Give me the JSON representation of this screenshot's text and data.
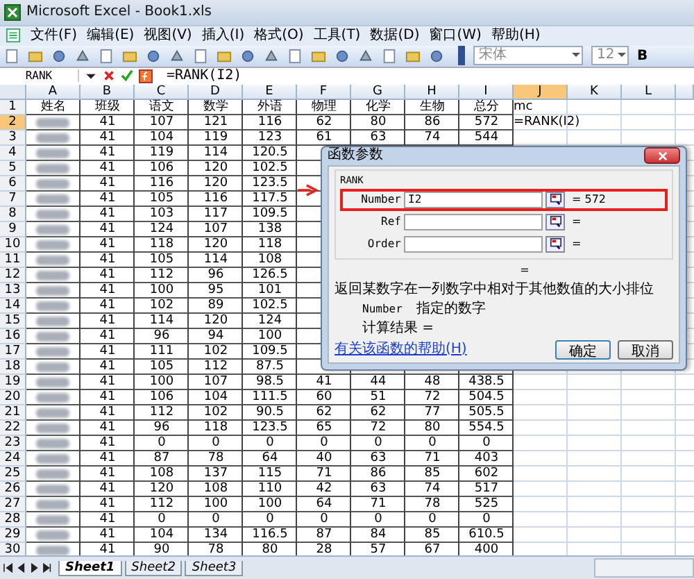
{
  "window": {
    "title": "Microsoft Excel - Book1.xls"
  },
  "menu": [
    "文件(F)",
    "编辑(E)",
    "视图(V)",
    "插入(I)",
    "格式(O)",
    "工具(T)",
    "数据(D)",
    "窗口(W)",
    "帮助(H)"
  ],
  "toolbar": {
    "font": "宋体",
    "size": "12",
    "bold": "B"
  },
  "formula_bar": {
    "name_box": "RANK",
    "formula": "=RANK(I2)"
  },
  "columns": [
    {
      "label": "A",
      "selected": false
    },
    {
      "label": "B",
      "selected": false
    },
    {
      "label": "C",
      "selected": false
    },
    {
      "label": "D",
      "selected": false
    },
    {
      "label": "E",
      "selected": false
    },
    {
      "label": "F",
      "selected": false
    },
    {
      "label": "G",
      "selected": false
    },
    {
      "label": "H",
      "selected": false
    },
    {
      "label": "I",
      "selected": false
    },
    {
      "label": "J",
      "selected": true
    },
    {
      "label": "K",
      "selected": false
    },
    {
      "label": "L",
      "selected": false
    }
  ],
  "rows": [
    {
      "number": "1",
      "selected": false,
      "name_blurred": false,
      "cells": [
        "姓名",
        "班级",
        "语文",
        "数学",
        "外语",
        "物理",
        "化学",
        "生物",
        "总分",
        "mc",
        null,
        null
      ]
    },
    {
      "number": "2",
      "selected": true,
      "name_blurred": true,
      "cells": [
        null,
        "41",
        "107",
        "121",
        "116",
        "62",
        "80",
        "86",
        "572",
        "=RANK(I2)",
        null,
        null
      ]
    },
    {
      "number": "3",
      "selected": false,
      "name_blurred": true,
      "cells": [
        null,
        "41",
        "104",
        "119",
        "123",
        "61",
        "63",
        "74",
        "544",
        null,
        null,
        null
      ]
    },
    {
      "number": "4",
      "selected": false,
      "name_blurred": true,
      "cells": [
        null,
        "41",
        "119",
        "114",
        "120.5",
        null,
        null,
        null,
        null,
        null,
        null,
        null
      ]
    },
    {
      "number": "5",
      "selected": false,
      "name_blurred": true,
      "cells": [
        null,
        "41",
        "106",
        "120",
        "102.5",
        null,
        null,
        null,
        null,
        null,
        null,
        null
      ]
    },
    {
      "number": "6",
      "selected": false,
      "name_blurred": true,
      "cells": [
        null,
        "41",
        "116",
        "120",
        "123.5",
        null,
        null,
        null,
        null,
        null,
        null,
        null
      ]
    },
    {
      "number": "7",
      "selected": false,
      "name_blurred": true,
      "cells": [
        null,
        "41",
        "105",
        "116",
        "117.5",
        null,
        null,
        null,
        null,
        null,
        null,
        null
      ]
    },
    {
      "number": "8",
      "selected": false,
      "name_blurred": true,
      "cells": [
        null,
        "41",
        "103",
        "117",
        "109.5",
        null,
        null,
        null,
        null,
        null,
        null,
        null
      ]
    },
    {
      "number": "9",
      "selected": false,
      "name_blurred": true,
      "cells": [
        null,
        "41",
        "124",
        "107",
        "138",
        null,
        null,
        null,
        null,
        null,
        null,
        null
      ]
    },
    {
      "number": "10",
      "selected": false,
      "name_blurred": true,
      "cells": [
        null,
        "41",
        "118",
        "120",
        "118",
        null,
        null,
        null,
        null,
        null,
        null,
        null
      ]
    },
    {
      "number": "11",
      "selected": false,
      "name_blurred": true,
      "cells": [
        null,
        "41",
        "105",
        "114",
        "108",
        null,
        null,
        null,
        null,
        null,
        null,
        null
      ]
    },
    {
      "number": "12",
      "selected": false,
      "name_blurred": true,
      "cells": [
        null,
        "41",
        "112",
        "96",
        "126.5",
        null,
        null,
        null,
        null,
        null,
        null,
        null
      ]
    },
    {
      "number": "13",
      "selected": false,
      "name_blurred": true,
      "cells": [
        null,
        "41",
        "100",
        "95",
        "101",
        null,
        null,
        null,
        null,
        null,
        null,
        null
      ]
    },
    {
      "number": "14",
      "selected": false,
      "name_blurred": true,
      "cells": [
        null,
        "41",
        "102",
        "89",
        "102.5",
        null,
        null,
        null,
        null,
        null,
        null,
        null
      ]
    },
    {
      "number": "15",
      "selected": false,
      "name_blurred": true,
      "cells": [
        null,
        "41",
        "114",
        "120",
        "124",
        null,
        null,
        null,
        null,
        null,
        null,
        null
      ]
    },
    {
      "number": "16",
      "selected": false,
      "name_blurred": true,
      "cells": [
        null,
        "41",
        "96",
        "94",
        "100",
        null,
        null,
        null,
        null,
        null,
        null,
        null
      ]
    },
    {
      "number": "17",
      "selected": false,
      "name_blurred": true,
      "cells": [
        null,
        "41",
        "111",
        "102",
        "109.5",
        null,
        null,
        null,
        null,
        null,
        null,
        null
      ]
    },
    {
      "number": "18",
      "selected": false,
      "name_blurred": true,
      "cells": [
        null,
        "41",
        "105",
        "112",
        "87.5",
        null,
        null,
        null,
        null,
        null,
        null,
        null
      ]
    },
    {
      "number": "19",
      "selected": false,
      "name_blurred": true,
      "cells": [
        null,
        "41",
        "100",
        "107",
        "98.5",
        "41",
        "44",
        "48",
        "438.5",
        null,
        null,
        null
      ]
    },
    {
      "number": "20",
      "selected": false,
      "name_blurred": true,
      "cells": [
        null,
        "41",
        "106",
        "104",
        "111.5",
        "60",
        "51",
        "72",
        "504.5",
        null,
        null,
        null
      ]
    },
    {
      "number": "21",
      "selected": false,
      "name_blurred": true,
      "cells": [
        null,
        "41",
        "112",
        "102",
        "90.5",
        "62",
        "62",
        "77",
        "505.5",
        null,
        null,
        null
      ]
    },
    {
      "number": "22",
      "selected": false,
      "name_blurred": true,
      "cells": [
        null,
        "41",
        "96",
        "118",
        "123.5",
        "65",
        "72",
        "80",
        "554.5",
        null,
        null,
        null
      ]
    },
    {
      "number": "23",
      "selected": false,
      "name_blurred": true,
      "cells": [
        null,
        "41",
        "0",
        "0",
        "0",
        "0",
        "0",
        "0",
        "0",
        null,
        null,
        null
      ]
    },
    {
      "number": "24",
      "selected": false,
      "name_blurred": true,
      "cells": [
        null,
        "41",
        "87",
        "78",
        "64",
        "40",
        "63",
        "71",
        "403",
        null,
        null,
        null
      ]
    },
    {
      "number": "25",
      "selected": false,
      "name_blurred": true,
      "cells": [
        null,
        "41",
        "108",
        "137",
        "115",
        "71",
        "86",
        "85",
        "602",
        null,
        null,
        null
      ]
    },
    {
      "number": "26",
      "selected": false,
      "name_blurred": true,
      "cells": [
        null,
        "41",
        "120",
        "108",
        "110",
        "42",
        "63",
        "74",
        "517",
        null,
        null,
        null
      ]
    },
    {
      "number": "27",
      "selected": false,
      "name_blurred": true,
      "cells": [
        null,
        "41",
        "112",
        "100",
        "100",
        "64",
        "71",
        "78",
        "525",
        null,
        null,
        null
      ]
    },
    {
      "number": "28",
      "selected": false,
      "name_blurred": true,
      "cells": [
        null,
        "41",
        "0",
        "0",
        "0",
        "0",
        "0",
        "0",
        "0",
        null,
        null,
        null
      ]
    },
    {
      "number": "29",
      "selected": false,
      "name_blurred": true,
      "cells": [
        null,
        "41",
        "104",
        "134",
        "116.5",
        "87",
        "84",
        "85",
        "610.5",
        null,
        null,
        null
      ]
    },
    {
      "number": "30",
      "selected": false,
      "name_blurred": true,
      "cells": [
        null,
        "41",
        "90",
        "78",
        "80",
        "28",
        "57",
        "67",
        "400",
        null,
        null,
        null
      ]
    }
  ],
  "dialog": {
    "title": "函数参数",
    "function": "RANK",
    "args": [
      {
        "label": "Number",
        "value": "I2",
        "result": "= 572",
        "highlighted": true
      },
      {
        "label": "Ref",
        "result": "=",
        "highlighted": false
      },
      {
        "label": "Order",
        "result": "=",
        "highlighted": false
      }
    ],
    "result_line": "=",
    "description": "返回某数字在一列数字中相对于其他数值的大小排位",
    "arg_help": {
      "label": "Number",
      "text": "指定的数字"
    },
    "calc_result": "计算结果 =",
    "help_link": "有关该函数的帮助(H)",
    "buttons": [
      "确定",
      "取消"
    ]
  },
  "sheet_tabs": [
    {
      "label": "Sheet1",
      "selected": true
    },
    {
      "label": "Sheet2",
      "selected": false
    },
    {
      "label": "Sheet3",
      "selected": false
    }
  ]
}
